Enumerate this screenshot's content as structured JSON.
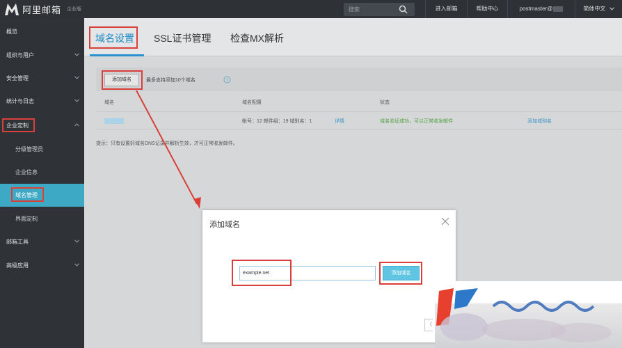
{
  "topbar": {
    "logo_text": "阿里邮箱",
    "logo_sub": "企业版",
    "search_placeholder": "搜索",
    "links": [
      "进入邮箱",
      "帮助中心",
      "postmaster@",
      "简体中文"
    ]
  },
  "sidebar": {
    "items": [
      {
        "label": "概览"
      },
      {
        "label": "组织与用户"
      },
      {
        "label": "安全管理"
      },
      {
        "label": "统计与日志"
      },
      {
        "label": "企业定制"
      },
      {
        "label": "分级管理员"
      },
      {
        "label": "企业信息"
      },
      {
        "label": "域名管理"
      },
      {
        "label": "界面定制"
      },
      {
        "label": "邮箱工具"
      },
      {
        "label": "高级应用"
      }
    ]
  },
  "main": {
    "tabs": [
      "域名设置",
      "SSL证书管理",
      "检查MX解析"
    ],
    "toolbar": {
      "add_button": "添加域名",
      "hint": "最多支持添加10个域名"
    },
    "table": {
      "headers": [
        "域名",
        "域名配置",
        "状态"
      ],
      "rows": [
        {
          "domain": "",
          "config": "帐号：12 邮件组：19 域别名：1",
          "detail_link": "详情",
          "status": "域名验证成功，可以正常收发邮件",
          "action_link": "添加域别名"
        }
      ]
    },
    "tip": "提示：只有设置好域名DNS记录并解析生效，才可正常收发邮件。"
  },
  "dialog": {
    "title": "添加域名",
    "input_value": "example.net",
    "submit_label": "添加域名"
  },
  "colors": {
    "accent": "#2a92cc",
    "annotation": "#d9403a",
    "sidebar_active": "#3da9c5"
  }
}
